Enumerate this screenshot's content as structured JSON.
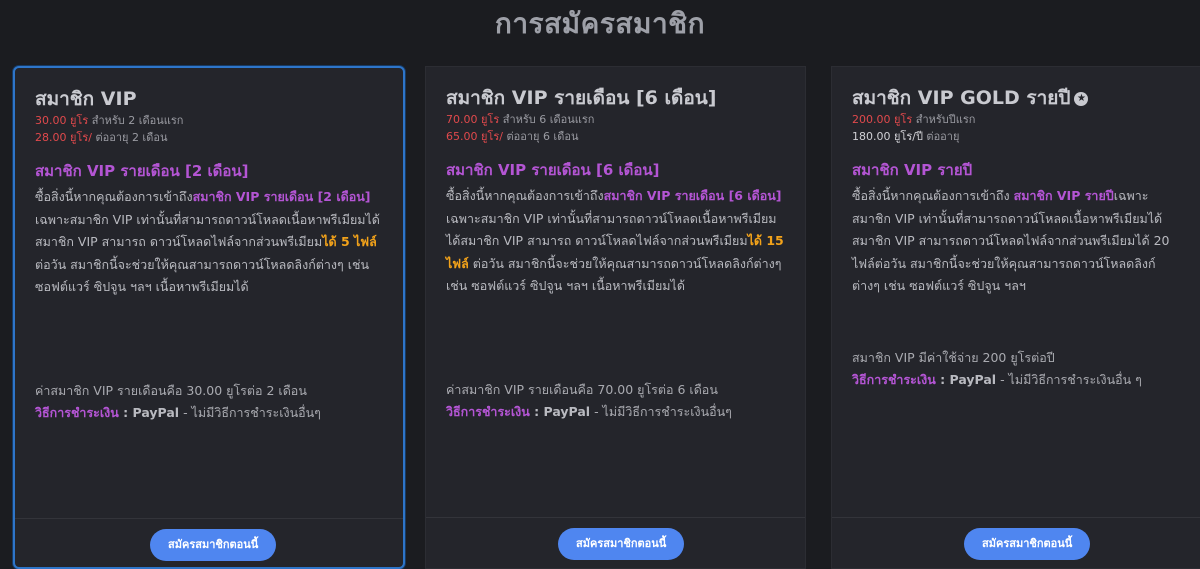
{
  "page_title": "การสมัครสมาชิก",
  "cards": [
    {
      "title": "สมาชิก VIP",
      "price1": "30.00 ยูโร",
      "price1_note": " สำหรับ 2 เดือนแรก",
      "price2": "28.00 ยูโร/",
      "price2_note": " ต่ออายุ 2 เดือน",
      "subhead": "สมาชิก VIP รายเดือน [2 เดือน]",
      "desc_a": "ซื้อสิ่งนี้หากคุณต้องการเข้าถึง",
      "desc_hl": "สมาชิก VIP รายเดือน [2 เดือน]",
      "desc_b": " เฉพาะสมาชิก VIP เท่านั้นที่สามารถดาวน์โหลดเนื้อหาพรีเมียมได้สมาชิก VIP สามารถ ดาวน์โหลดไฟล์จากส่วนพรีเมียม",
      "desc_yellow": "ได้ 5 ไฟล์",
      "desc_c": " ต่อวัน สมาชิกนี้จะช่วยให้คุณสามารถดาวน์โหลดลิงก์ต่างๆ เช่น ซอฟต์แวร์ ซิปจูน ฯลฯ เนื้อหาพรีเมียมได้",
      "fee": "ค่าสมาชิก VIP รายเดือนคือ 30.00 ยูโรต่อ 2 เดือน",
      "pay_label": "วิธีการชำระเงิน",
      "pay_value": " : PayPal",
      "pay_note": " - ไม่มีวิธีการชำระเงินอื่นๆ",
      "button": "สมัครสมาชิกตอนนี้"
    },
    {
      "title": "สมาชิก VIP รายเดือน [6 เดือน]",
      "price1": "70.00 ยูโร",
      "price1_note": " สำหรับ 6 เดือนแรก",
      "price2": "65.00 ยูโร/",
      "price2_note": " ต่ออายุ 6 เดือน",
      "subhead": "สมาชิก VIP รายเดือน [6 เดือน]",
      "desc_a": "ซื้อสิ่งนี้หากคุณต้องการเข้าถึง",
      "desc_hl": "สมาชิก VIP รายเดือน [6 เดือน]",
      "desc_b": " เฉพาะสมาชิก VIP เท่านั้นที่สามารถดาวน์โหลดเนื้อหาพรีเมียมได้สมาชิก VIP สามารถ ดาวน์โหลดไฟล์จากส่วนพรีเมียม",
      "desc_yellow": "ได้ 15 ไฟล์",
      "desc_c": " ต่อวัน สมาชิกนี้จะช่วยให้คุณสามารถดาวน์โหลดลิงก์ต่างๆ เช่น ซอฟต์แวร์ ซิปจูน ฯลฯ เนื้อหาพรีเมียมได้",
      "fee": "ค่าสมาชิก VIP รายเดือนคือ 70.00 ยูโรต่อ 6 เดือน",
      "pay_label": "วิธีการชำระเงิน",
      "pay_value": " : PayPal",
      "pay_note": " - ไม่มีวิธีการชำระเงินอื่นๆ",
      "button": "สมัครสมาชิกตอนนี้"
    },
    {
      "title": "สมาชิก VIP GOLD รายปี",
      "price1": "200.00 ยูโร",
      "price1_note": " สำหรับปีแรก",
      "price2": "180.00 ยูโร/ปี",
      "price2_note": " ต่ออายุ",
      "subhead": "สมาชิก VIP รายปี",
      "desc_a": "ซื้อสิ่งนี้หากคุณต้องการเข้าถึง ",
      "desc_hl": "สมาชิก VIP รายปี",
      "desc_b": "เฉพาะสมาชิก VIP เท่านั้นที่สามารถดาวน์โหลดเนื้อหาพรีเมียมได้ สมาชิก VIP สามารถดาวน์โหลดไฟล์จากส่วนพรีเมียมได้ 20 ไฟล์ต่อวัน สมาชิกนี้จะช่วยให้คุณสามารถดาวน์โหลดลิงก์ต่างๆ เช่น ซอฟต์แวร์ ซิปจูน ฯลฯ",
      "desc_yellow": "",
      "desc_c": "",
      "fee": "สมาชิก VIP มีค่าใช้จ่าย 200 ยูโรต่อปี",
      "pay_label": "วิธีการชำระเงิน",
      "pay_value": " : PayPal",
      "pay_note": " - ไม่มีวิธีการชำระเงินอื่น ๆ",
      "button": "สมัครสมาชิกตอนนี้"
    }
  ],
  "colors": {
    "background": "#1b1c20",
    "card": "#24252b",
    "accent_purple": "#b455d4",
    "price_red": "#e0494c",
    "highlight_yellow": "#f2a21a",
    "button_blue": "#4f86f0",
    "selected_border": "#2e75c9"
  },
  "icons": {
    "gold_badge": "star-icon"
  }
}
